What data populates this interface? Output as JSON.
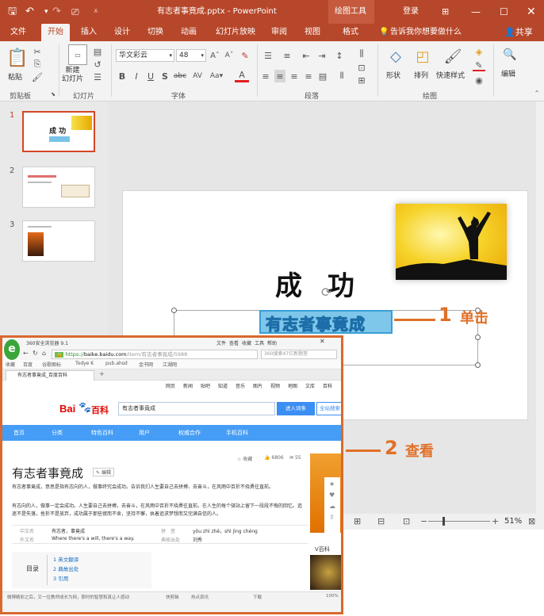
{
  "window": {
    "title": "有志者事竟成.pptx - PowerPoint",
    "context_tab": "绘图工具",
    "login": "登录"
  },
  "ribbon_tabs": [
    "文件",
    "开始",
    "插入",
    "设计",
    "切换",
    "动画",
    "幻灯片放映",
    "审阅",
    "视图",
    "格式"
  ],
  "tell_me": "告诉我你想要做什么",
  "share": "共享",
  "groups": {
    "clipboard": "剪贴板",
    "slides": "幻灯片",
    "font": "字体",
    "paragraph": "段落",
    "drawing": "绘图",
    "editing": "编辑"
  },
  "clipboard": {
    "paste": "粘贴"
  },
  "slides_group": {
    "new_slide": "新建\n幻灯片"
  },
  "font": {
    "family": "华文彩云",
    "size": "48"
  },
  "drawing": {
    "shape": "形状",
    "arrange": "排列",
    "quick_styles": "快速样式"
  },
  "thumbnails": [
    {
      "num": "1",
      "title": "成 功",
      "subtitle": "有志者事竟成"
    },
    {
      "num": "2"
    },
    {
      "num": "3"
    }
  ],
  "slide": {
    "title": "成 功",
    "subtitle": "有志者事竟成"
  },
  "callouts": [
    {
      "num": "1",
      "label": "单击"
    },
    {
      "num": "2",
      "label": "查看"
    }
  ],
  "status": {
    "zoom": "51%"
  },
  "browser": {
    "app": "360安全浏览器 9.1",
    "url_prefix": "https://",
    "url_domain": "baike.baidu.com",
    "url_path": "/item/有志者事竟成/5988",
    "search_hint": "360搜索47亿新题答",
    "tab_title": "有志者事竟成_百度百科",
    "menu": [
      "文件",
      "查看",
      "收藏",
      "工具",
      "帮助"
    ],
    "bookmarks": [
      "收藏",
      "百度",
      "谷歌图标",
      "Todye K",
      "pub.ahsd",
      "金书网",
      "江湖网"
    ],
    "top_nav": [
      "网页",
      "新闻",
      "贴吧",
      "知道",
      "音乐",
      "图片",
      "视频",
      "地图",
      "文库",
      "百科"
    ],
    "search_value": "有志者事竟成",
    "search_btn": "进入词条",
    "search_btn2": "全站搜索",
    "blue_nav": [
      "首页",
      "分类",
      "特色百科",
      "用户",
      "权威合作",
      "手机百科"
    ],
    "entry_title": "有志者事竟成",
    "edit_label": "编辑",
    "action_collect": "收藏",
    "action_like": "6806",
    "action_share": "55",
    "para1": "有志者事竟成，意思是指有志向的人，做事终究会成功。告诉我们人生要自己去拼搏、去奋斗，在风雨中百折不挠勇往直前。",
    "para2": "有志向的人，做事一定会成功。人生要自己去拼搏，去奋斗，在风雨中百折不挠勇往直前。在人生的每个驿站上留下一段段不悔的回忆。追逐不是失落，挫折不是放弃，成功属于那些锲而不舍，坚持不懈，执着追求梦想而又完满自信的人。",
    "info_rows": [
      [
        "中文名",
        "有志者，事竟成",
        "拼　音",
        "yǒu zhì zhě，shì jìng chéng"
      ],
      [
        "外文名",
        "Where there's a will, there's a way.",
        "典故出处",
        "刘秀"
      ]
    ],
    "toc_label": "目录",
    "toc": [
      "1  英文翻译",
      "2  典故出处",
      "3  引用"
    ],
    "right_label": "V百科",
    "bottom_status": "微博精彩之后，又一位教师成长为网，那时的智慧和真让人感动",
    "bottom_tools": [
      "快剪辑",
      "热点资讯",
      "下载",
      "100%"
    ]
  }
}
